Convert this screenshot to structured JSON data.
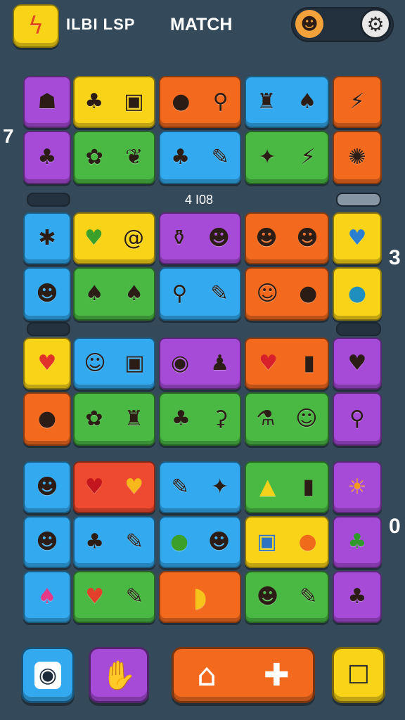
{
  "header": {
    "title": "MATCH",
    "score_label": "ILBI LSP",
    "logo_icon": "lightning-swirl-logo",
    "profile_icon": "player-avatar",
    "settings_icon": "gear-icon"
  },
  "board": {
    "center_counter": "4 I08",
    "side_numbers": {
      "left": "7",
      "right_mid": "3",
      "right_low": "0"
    }
  },
  "glyphs": {
    "r1": [
      "☗",
      "♣",
      "▣",
      "●",
      "⚲",
      "♜",
      "♠",
      "⚡"
    ],
    "r2": [
      "♣",
      "✿",
      "❦",
      "♣",
      "✎",
      "✦",
      "⚡",
      "✺"
    ],
    "r3": [
      "✱",
      "♥",
      "@",
      "⚱",
      "☻",
      "☻",
      "☻",
      "♥"
    ],
    "r4": [
      "☻",
      "♠",
      "♠",
      "⚲",
      "✎",
      "☺",
      "●",
      "●"
    ],
    "r5": [
      "♥",
      "☺",
      "▣",
      "◉",
      "♟",
      "♥",
      "▮",
      "♥"
    ],
    "r6": [
      "●",
      "✿",
      "♜",
      "♣",
      "⚳",
      "⚗",
      "☺",
      "⚲"
    ],
    "r7": [
      "☻",
      "♥",
      "♥",
      "✎",
      "✦",
      "▲",
      "▮",
      "☀"
    ],
    "r8": [
      "☻",
      "♣",
      "✎",
      "●",
      "☻",
      "▣",
      "●",
      "♣"
    ],
    "r9": [
      "♠",
      "♥",
      "✎",
      "◗",
      "☻",
      "✎",
      "♣"
    ]
  },
  "footer": {
    "camera_icon": "camera-icon",
    "hand_icon": "hand-icon",
    "home_icon": "home-icon",
    "puzzle_icon": "puzzle-icon",
    "robot_icon": "robot-icon",
    "home_glyph": "⌂",
    "puzzle_glyph": "✚",
    "camera_glyph": "◉",
    "hand_glyph": "✋",
    "robot_glyph": "☐"
  },
  "colors": {
    "background": "#34495a",
    "yellow": "#f8d317",
    "purple": "#a64ad8",
    "orange": "#f36a1f",
    "blue": "#33a9f0",
    "green": "#49b944"
  }
}
